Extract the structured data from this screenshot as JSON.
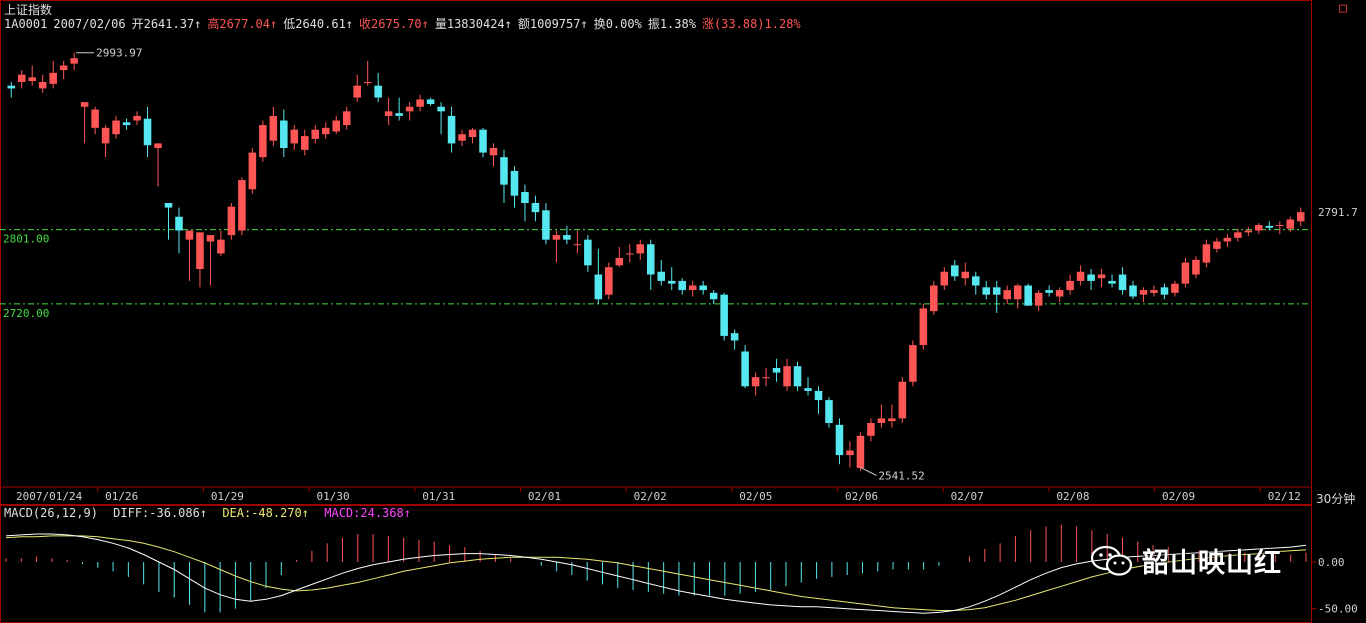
{
  "header": {
    "title": "上证指数",
    "info": [
      {
        "text": "1A0001",
        "color": "w"
      },
      {
        "text": "2007/02/06",
        "color": "w"
      },
      {
        "text": "开2641.37↑",
        "color": "w"
      },
      {
        "text": "高2677.04↑",
        "color": "r"
      },
      {
        "text": "低2640.61↑",
        "color": "w"
      },
      {
        "text": "收2675.70↑",
        "color": "r"
      },
      {
        "text": "量13830424↑",
        "color": "w"
      },
      {
        "text": "额1009757↑",
        "color": "w"
      },
      {
        "text": "换0.00%",
        "color": "w"
      },
      {
        "text": "振1.38%",
        "color": "w"
      },
      {
        "text": "涨(33.88)1.28%",
        "color": "r"
      }
    ]
  },
  "macd_header": {
    "params": "MACD(26,12,9)",
    "diff": "DIFF:-36.086↑",
    "dea": "DEA:-48.270↑",
    "macd": "MACD:24.368↑"
  },
  "period_label": "30分钟",
  "watermark_text": "韶山映山红",
  "colors": {
    "up": "#ff5555",
    "down": "#55e8f0",
    "grid": "#a00000",
    "dash": "#44dd44",
    "diff": "#ffffff",
    "dea": "#e8e870"
  },
  "chart_data": {
    "type": "candlestick",
    "price_axis": {
      "labels": [
        "2801.00",
        "2720.00"
      ],
      "values": [
        2801,
        2720
      ],
      "right_label": "2791.7",
      "ylim": [
        2530,
        3010
      ]
    },
    "x_labels": [
      "2007/01/24",
      "01/26",
      "01/29",
      "01/30",
      "01/31",
      "02/01",
      "02/02",
      "02/05",
      "02/06",
      "02/07",
      "02/08",
      "02/09",
      "02/12"
    ],
    "annotations": [
      {
        "text": "2993.97",
        "value": 2993.97
      },
      {
        "text": "2541.52",
        "value": 2541.52
      }
    ],
    "candles": [
      [
        2958,
        2962,
        2945,
        2955
      ],
      [
        2962,
        2975,
        2955,
        2970
      ],
      [
        2963,
        2980,
        2958,
        2967
      ],
      [
        2955,
        2970,
        2950,
        2962
      ],
      [
        2960,
        2985,
        2955,
        2972
      ],
      [
        2975,
        2985,
        2965,
        2980
      ],
      [
        2982,
        2994,
        2975,
        2988
      ],
      [
        2935,
        2938,
        2895,
        2940
      ],
      [
        2912,
        2935,
        2905,
        2932
      ],
      [
        2895,
        2915,
        2880,
        2912
      ],
      [
        2905,
        2925,
        2900,
        2920
      ],
      [
        2918,
        2922,
        2910,
        2915
      ],
      [
        2920,
        2930,
        2915,
        2925
      ],
      [
        2922,
        2935,
        2880,
        2893
      ],
      [
        2890,
        2892,
        2848,
        2895
      ],
      [
        2830,
        2830,
        2790,
        2825
      ],
      [
        2815,
        2825,
        2775,
        2800
      ],
      [
        2790,
        2795,
        2745,
        2800
      ],
      [
        2758,
        2760,
        2738,
        2798
      ],
      [
        2788,
        2792,
        2740,
        2795
      ],
      [
        2775,
        2800,
        2772,
        2790
      ],
      [
        2795,
        2830,
        2790,
        2826
      ],
      [
        2800,
        2858,
        2795,
        2855
      ],
      [
        2845,
        2890,
        2840,
        2885
      ],
      [
        2880,
        2920,
        2875,
        2915
      ],
      [
        2898,
        2935,
        2892,
        2925
      ],
      [
        2920,
        2932,
        2880,
        2890
      ],
      [
        2895,
        2915,
        2888,
        2910
      ],
      [
        2888,
        2910,
        2882,
        2903
      ],
      [
        2900,
        2915,
        2895,
        2910
      ],
      [
        2905,
        2918,
        2900,
        2912
      ],
      [
        2908,
        2925,
        2905,
        2920
      ],
      [
        2915,
        2935,
        2910,
        2930
      ],
      [
        2945,
        2970,
        2940,
        2958
      ],
      [
        2962,
        2985,
        2958,
        2962
      ],
      [
        2958,
        2972,
        2940,
        2945
      ],
      [
        2925,
        2945,
        2915,
        2930
      ],
      [
        2928,
        2945,
        2920,
        2925
      ],
      [
        2930,
        2940,
        2920,
        2935
      ],
      [
        2935,
        2948,
        2930,
        2943
      ],
      [
        2943,
        2945,
        2936,
        2938
      ],
      [
        2935,
        2940,
        2905,
        2930
      ],
      [
        2925,
        2935,
        2885,
        2895
      ],
      [
        2898,
        2910,
        2892,
        2905
      ],
      [
        2902,
        2912,
        2895,
        2910
      ],
      [
        2910,
        2912,
        2880,
        2885
      ],
      [
        2882,
        2895,
        2870,
        2890
      ],
      [
        2880,
        2888,
        2830,
        2850
      ],
      [
        2865,
        2870,
        2825,
        2838
      ],
      [
        2842,
        2850,
        2810,
        2830
      ],
      [
        2830,
        2838,
        2810,
        2820
      ],
      [
        2822,
        2830,
        2785,
        2790
      ],
      [
        2790,
        2800,
        2765,
        2795
      ],
      [
        2795,
        2805,
        2785,
        2790
      ],
      [
        2785,
        2800,
        2775,
        2785
      ],
      [
        2790,
        2795,
        2755,
        2762
      ],
      [
        2752,
        2780,
        2720,
        2725
      ],
      [
        2730,
        2765,
        2725,
        2760
      ],
      [
        2762,
        2782,
        2760,
        2770
      ],
      [
        2775,
        2785,
        2765,
        2775
      ],
      [
        2775,
        2790,
        2768,
        2785
      ],
      [
        2785,
        2790,
        2735,
        2752
      ],
      [
        2755,
        2768,
        2740,
        2745
      ],
      [
        2745,
        2760,
        2735,
        2742
      ],
      [
        2745,
        2748,
        2730,
        2735
      ],
      [
        2735,
        2745,
        2728,
        2740
      ],
      [
        2740,
        2745,
        2730,
        2735
      ],
      [
        2732,
        2735,
        2720,
        2725
      ],
      [
        2730,
        2732,
        2680,
        2685
      ],
      [
        2688,
        2692,
        2670,
        2680
      ],
      [
        2668,
        2675,
        2628,
        2630
      ],
      [
        2630,
        2645,
        2620,
        2640
      ],
      [
        2640,
        2650,
        2630,
        2640
      ],
      [
        2650,
        2660,
        2635,
        2645
      ],
      [
        2630,
        2660,
        2625,
        2652
      ],
      [
        2652,
        2657,
        2625,
        2630
      ],
      [
        2628,
        2640,
        2620,
        2625
      ],
      [
        2625,
        2630,
        2600,
        2615
      ],
      [
        2615,
        2618,
        2585,
        2590
      ],
      [
        2588,
        2595,
        2545,
        2555
      ],
      [
        2555,
        2570,
        2541.52,
        2560
      ],
      [
        2541,
        2580,
        2538,
        2576
      ],
      [
        2576,
        2595,
        2570,
        2590
      ],
      [
        2590,
        2610,
        2585,
        2595
      ],
      [
        2592,
        2610,
        2585,
        2595
      ],
      [
        2595,
        2640,
        2590,
        2635
      ],
      [
        2635,
        2680,
        2630,
        2675
      ],
      [
        2675,
        2720,
        2670,
        2715
      ],
      [
        2712,
        2745,
        2708,
        2740
      ],
      [
        2740,
        2760,
        2735,
        2755
      ],
      [
        2762,
        2768,
        2745,
        2750
      ],
      [
        2748,
        2765,
        2740,
        2755
      ],
      [
        2750,
        2755,
        2730,
        2740
      ],
      [
        2738,
        2745,
        2725,
        2730
      ],
      [
        2738,
        2745,
        2710,
        2730
      ],
      [
        2725,
        2740,
        2720,
        2735
      ],
      [
        2725,
        2742,
        2715,
        2740
      ],
      [
        2740,
        2742,
        2718,
        2718
      ],
      [
        2718,
        2735,
        2712,
        2732
      ],
      [
        2735,
        2740,
        2728,
        2732
      ],
      [
        2728,
        2738,
        2722,
        2735
      ],
      [
        2735,
        2752,
        2730,
        2745
      ],
      [
        2745,
        2762,
        2740,
        2755
      ],
      [
        2752,
        2758,
        2735,
        2745
      ],
      [
        2748,
        2758,
        2738,
        2752
      ],
      [
        2745,
        2752,
        2738,
        2742
      ],
      [
        2752,
        2760,
        2730,
        2735
      ],
      [
        2740,
        2745,
        2725,
        2728
      ],
      [
        2730,
        2738,
        2722,
        2735
      ],
      [
        2732,
        2740,
        2728,
        2735
      ],
      [
        2738,
        2742,
        2725,
        2730
      ],
      [
        2732,
        2745,
        2728,
        2742
      ],
      [
        2742,
        2770,
        2738,
        2765
      ],
      [
        2752,
        2772,
        2748,
        2768
      ],
      [
        2765,
        2790,
        2760,
        2785
      ],
      [
        2780,
        2792,
        2776,
        2788
      ],
      [
        2788,
        2796,
        2782,
        2792
      ],
      [
        2792,
        2802,
        2788,
        2798
      ],
      [
        2798,
        2804,
        2794,
        2800
      ],
      [
        2800,
        2808,
        2796,
        2806
      ],
      [
        2805,
        2810,
        2800,
        2803
      ],
      [
        2805,
        2810,
        2796,
        2806
      ],
      [
        2802,
        2815,
        2798,
        2812
      ],
      [
        2810,
        2825,
        2805,
        2820
      ]
    ],
    "macd": {
      "ylim": [
        -60,
        45
      ],
      "axis_labels": [
        "0.00",
        "-50.00"
      ],
      "axis_values": [
        0,
        -50
      ],
      "diff": [
        28,
        29,
        30,
        30,
        29,
        27,
        24,
        20,
        15,
        8,
        0,
        -8,
        -18,
        -28,
        -35,
        -40,
        -42,
        -40,
        -36,
        -30,
        -24,
        -18,
        -12,
        -7,
        -3,
        0,
        3,
        5,
        7,
        8,
        9,
        9,
        8,
        7,
        5,
        3,
        0,
        -3,
        -7,
        -11,
        -15,
        -19,
        -23,
        -27,
        -31,
        -34,
        -37,
        -40,
        -42,
        -44,
        -46,
        -47,
        -48,
        -48,
        -49,
        -50,
        -51,
        -52,
        -53,
        -54,
        -55,
        -54,
        -52,
        -48,
        -42,
        -35,
        -27,
        -19,
        -12,
        -6,
        -2,
        1,
        3,
        5,
        6,
        7,
        8,
        9,
        10,
        11,
        12,
        13,
        14,
        15,
        16,
        18
      ],
      "dea": [
        26,
        27,
        27,
        28,
        28,
        28,
        27,
        25,
        23,
        20,
        16,
        11,
        5,
        -1,
        -8,
        -15,
        -21,
        -26,
        -29,
        -31,
        -30,
        -28,
        -25,
        -22,
        -18,
        -14,
        -10,
        -7,
        -4,
        -1,
        1,
        3,
        4,
        5,
        5,
        5,
        5,
        4,
        3,
        1,
        -1,
        -4,
        -7,
        -10,
        -13,
        -16,
        -19,
        -22,
        -25,
        -28,
        -31,
        -34,
        -37,
        -39,
        -41,
        -43,
        -45,
        -47,
        -49,
        -50,
        -51,
        -52,
        -52,
        -51,
        -49,
        -45,
        -41,
        -36,
        -31,
        -26,
        -21,
        -16,
        -12,
        -8,
        -5,
        -2,
        0,
        2,
        4,
        5,
        7,
        8,
        9,
        11,
        12,
        13
      ]
    }
  }
}
